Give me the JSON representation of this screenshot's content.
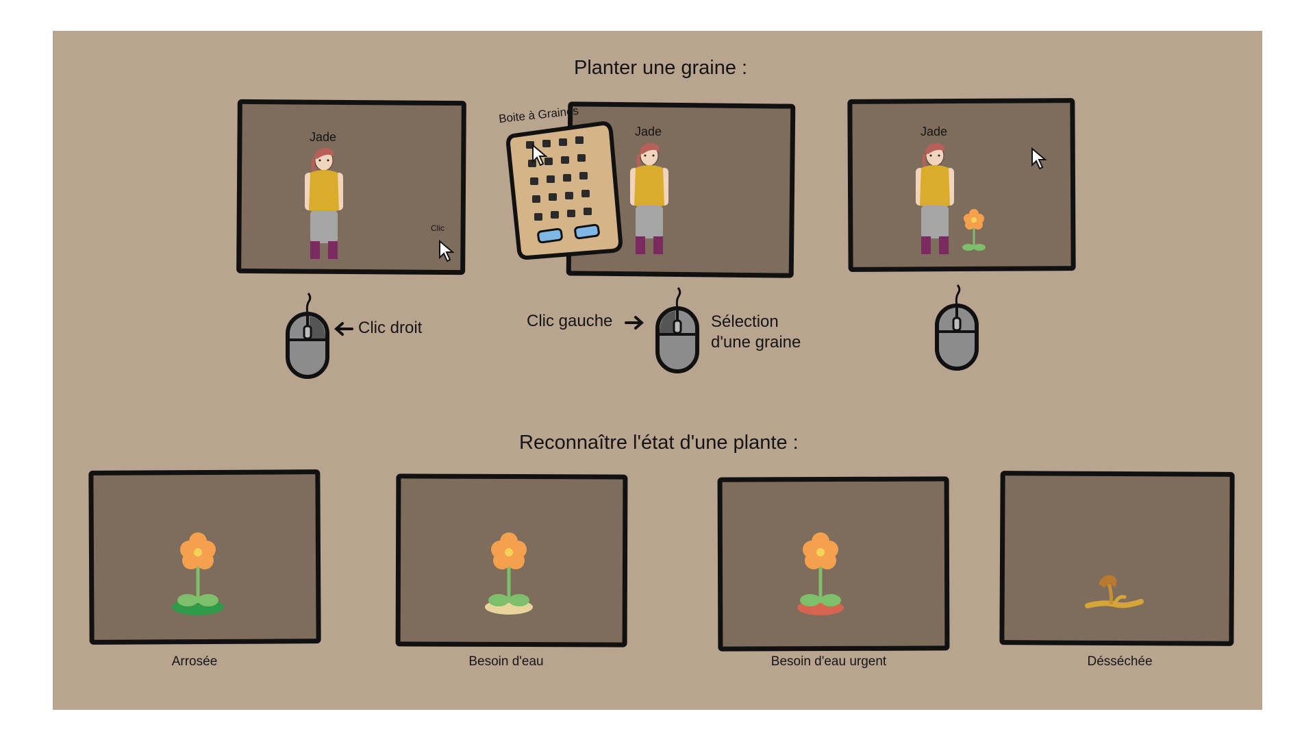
{
  "planting": {
    "title": "Planter une graine :",
    "panels": [
      {
        "character_name": "Jade",
        "click_hint": "Clic"
      },
      {
        "character_name": "Jade",
        "seed_box_label": "Boite à Graines"
      },
      {
        "character_name": "Jade"
      }
    ],
    "mouse_hints": {
      "right_click": "Clic droit",
      "left_click": "Clic gauche",
      "selection_line1": "Sélection",
      "selection_line2": "d'une graine"
    }
  },
  "plant_states": {
    "title": "Reconnaître l'état d'une plante :",
    "states": [
      {
        "label": "Arrosée",
        "soil_color": "#2f9a4a"
      },
      {
        "label": "Besoin d'eau",
        "soil_color": "#e8d59b"
      },
      {
        "label": "Besoin d'eau urgent",
        "soil_color": "#d7644e"
      },
      {
        "label": "Désséchée",
        "soil_color": "#d6a53a"
      }
    ]
  },
  "colors": {
    "board": "#b8a48f",
    "panel": "#7e6c5c",
    "flower_petal": "#f5a04c",
    "flower_center": "#f7d25a",
    "stem": "#7dbf6a",
    "jacket": "#d9ac2b",
    "boots": "#7a2a5e"
  }
}
